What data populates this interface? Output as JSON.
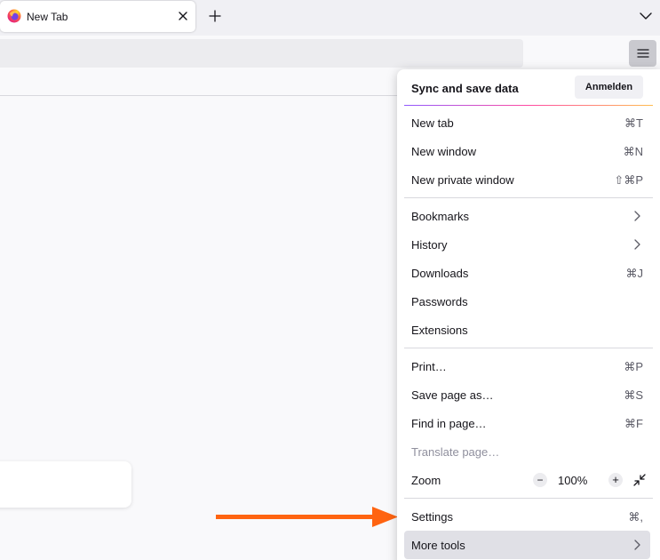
{
  "tabs": [
    {
      "title": "New Tab",
      "favicon": "firefox-icon",
      "active": true
    }
  ],
  "toolbar": {
    "menu_icon": "hamburger-menu-icon",
    "new_tab_icon": "plus-icon",
    "list_tabs_icon": "chevron-down-icon"
  },
  "menu": {
    "header": {
      "title": "Sync and save data",
      "signin_label": "Anmelden"
    },
    "items": [
      {
        "label": "New tab",
        "shortcut": "⌘T"
      },
      {
        "label": "New window",
        "shortcut": "⌘N"
      },
      {
        "label": "New private window",
        "shortcut": "⇧⌘P"
      },
      {
        "label": "Bookmarks",
        "shortcut": ""
      },
      {
        "label": "History",
        "shortcut": ""
      },
      {
        "label": "Downloads",
        "shortcut": "⌘J"
      },
      {
        "label": "Passwords",
        "shortcut": ""
      },
      {
        "label": "Extensions",
        "shortcut": ""
      },
      {
        "label": "Print…",
        "shortcut": "⌘P"
      },
      {
        "label": "Save page as…",
        "shortcut": "⌘S"
      },
      {
        "label": "Find in page…",
        "shortcut": "⌘F"
      },
      {
        "label": "Translate page…",
        "shortcut": ""
      },
      {
        "label": "Settings",
        "shortcut": "⌘,"
      },
      {
        "label": "More tools",
        "shortcut": ""
      }
    ],
    "zoom": {
      "label": "Zoom",
      "minus": "−",
      "value": "100%",
      "plus": "+"
    }
  },
  "colors": {
    "accent_arrow": "#ff6411",
    "hover_background": "#e0e0e6",
    "disabled_text": "#8f8f9d"
  }
}
